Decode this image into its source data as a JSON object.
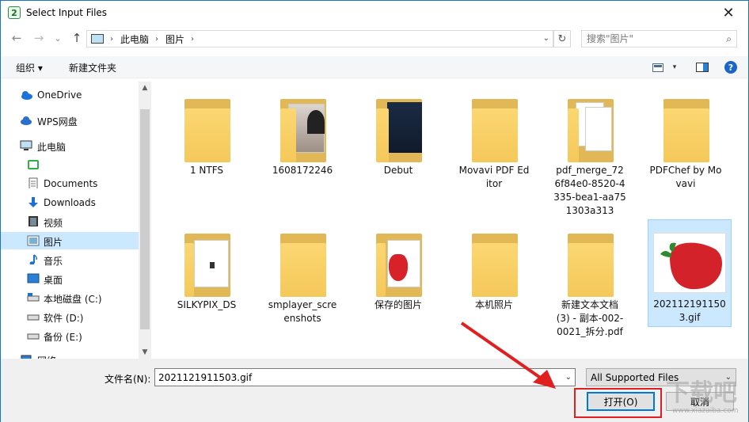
{
  "window": {
    "title": "Select Input Files",
    "app_icon": "2",
    "close": "✕"
  },
  "nav": {
    "back": "←",
    "forward": "→",
    "recent": "⌄",
    "up": "↑",
    "breadcrumbs": [
      "此电脑",
      "图片"
    ],
    "search_placeholder": "搜索\"图片\""
  },
  "toolbar": {
    "organize": "组织 ▾",
    "new_folder": "新建文件夹",
    "help": "?"
  },
  "sidebar": {
    "items": [
      {
        "label": "OneDrive",
        "icon": "cloud-icon"
      },
      {
        "label": "WPS网盘",
        "icon": "wps-cloud-icon"
      },
      {
        "label": "此电脑",
        "icon": "computer-icon"
      },
      {
        "label": "",
        "icon": "app-green-icon"
      },
      {
        "label": "Documents",
        "icon": "document-icon"
      },
      {
        "label": "Downloads",
        "icon": "download-icon"
      },
      {
        "label": "视频",
        "icon": "video-icon"
      },
      {
        "label": "图片",
        "icon": "pictures-icon"
      },
      {
        "label": "音乐",
        "icon": "music-icon"
      },
      {
        "label": "桌面",
        "icon": "desktop-icon"
      },
      {
        "label": "本地磁盘 (C:)",
        "icon": "drive-icon"
      },
      {
        "label": "软件 (D:)",
        "icon": "drive-icon"
      },
      {
        "label": "备份 (E:)",
        "icon": "drive-icon"
      },
      {
        "label": "网络",
        "icon": "network-icon"
      }
    ]
  },
  "files": [
    {
      "name": "1 NTFS"
    },
    {
      "name": "1608172246"
    },
    {
      "name": "Debut"
    },
    {
      "name": "Movavi PDF Editor"
    },
    {
      "name": "pdf_merge_726f84e0-8520-4335-bea1-aa751303a313"
    },
    {
      "name": "PDFChef by Movavi"
    },
    {
      "name": "SILKYPIX_DS"
    },
    {
      "name": "smplayer_screenshots"
    },
    {
      "name": "保存的图片"
    },
    {
      "name": "本机照片"
    },
    {
      "name": "新建文本文档 (3) - 副本-002-0021_拆分.pdf"
    },
    {
      "name": "2021121911503.gif"
    }
  ],
  "bottom": {
    "filename_label": "文件名(N):",
    "filename_value": "2021121911503.gif",
    "filter_value": "All Supported Files",
    "open_button": "打开(O)",
    "cancel_button": "取消"
  },
  "watermark": {
    "text": "下载吧",
    "url": "www.xiazaiba.com"
  },
  "colors": {
    "accent": "#0078d7",
    "selection": "#cce8ff",
    "folder": "#f5c85a",
    "annotation": "#e02020"
  }
}
